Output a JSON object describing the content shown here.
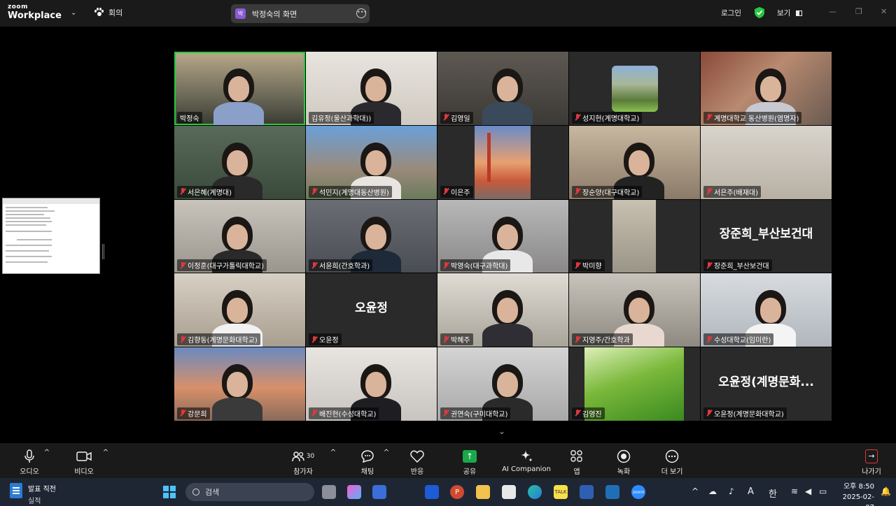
{
  "topbar": {
    "logo_line1": "zoom",
    "logo_line2": "Workplace",
    "meeting_label": "회의",
    "share_badge": "박",
    "share_title": "박정숙의 화면",
    "login_label": "로그인",
    "view_label": "보기"
  },
  "participants": [
    {
      "name": "박정숙",
      "muted": false,
      "active": true
    },
    {
      "name": "김유정(울산과학대))",
      "muted": false
    },
    {
      "name": "김영일",
      "muted": true
    },
    {
      "name": "성지현(계명대학교)",
      "muted": true
    },
    {
      "name": "계명대학교 동산병원(염명자)",
      "muted": true
    },
    {
      "name": "서은혜(계명대)",
      "muted": true
    },
    {
      "name": "석민지(계명대동산병원)",
      "muted": true
    },
    {
      "name": "이은주",
      "muted": true
    },
    {
      "name": "장순양(대구대학교)",
      "muted": true
    },
    {
      "name": "서은주(배재대)",
      "muted": true
    },
    {
      "name": "이정훈(대구가톨릭대학교)",
      "muted": true
    },
    {
      "name": "서윤희(간호학과)",
      "muted": true
    },
    {
      "name": "박영숙(대구과학대)",
      "muted": true
    },
    {
      "name": "박미향",
      "muted": true
    },
    {
      "name": "장준희_부산보건대",
      "muted": true,
      "big": "장준희_부산보건대"
    },
    {
      "name": "김향동(계명문화대학교)",
      "muted": true
    },
    {
      "name": "오윤정",
      "muted": true,
      "big": "오윤정"
    },
    {
      "name": "박혜주",
      "muted": true
    },
    {
      "name": "지영주/간호학과",
      "muted": true
    },
    {
      "name": "수성대학교(임미란)",
      "muted": true
    },
    {
      "name": "강문희",
      "muted": true
    },
    {
      "name": "배진현(수성대학교)",
      "muted": true
    },
    {
      "name": "권연숙(구미대학교)",
      "muted": true
    },
    {
      "name": "김영진",
      "muted": true
    },
    {
      "name": "오윤정(계명문화대학교)",
      "muted": true,
      "big": "오윤정(계명문화..."
    }
  ],
  "toolbar": {
    "audio": "오디오",
    "video": "비디오",
    "participants": "참가자",
    "participants_count": "30",
    "chat": "채팅",
    "reactions": "반응",
    "share": "공유",
    "ai_companion": "AI Companion",
    "apps": "앱",
    "record": "녹화",
    "more": "더 보기",
    "leave": "나가기"
  },
  "taskbar": {
    "app_title": "발표 직전",
    "app_subtitle": "실적",
    "search_label": "검색",
    "ime_letter": "A",
    "ime_hangul": "한",
    "time": "오후 8:50",
    "date": "2025-02-07"
  }
}
